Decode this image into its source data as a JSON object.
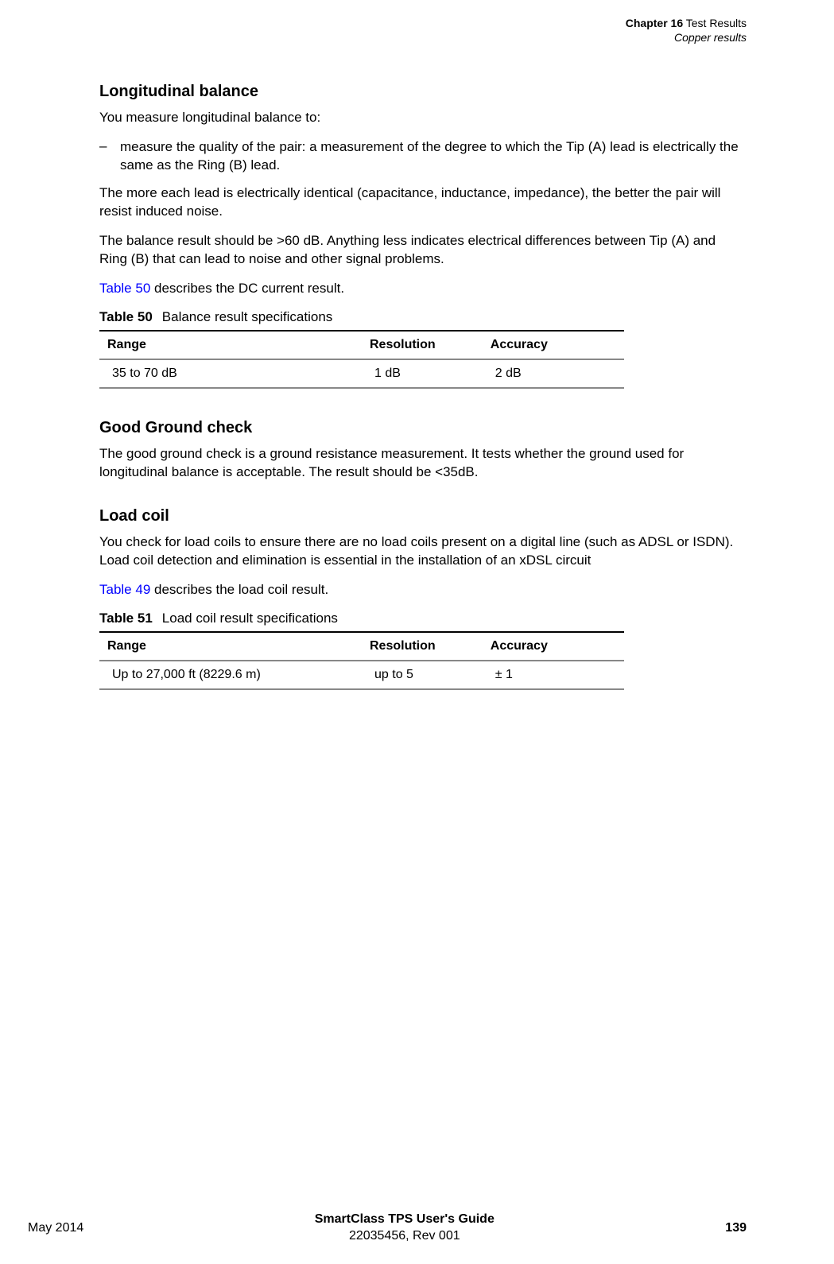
{
  "header": {
    "chapter_label": "Chapter 16",
    "chapter_title": "Test Results",
    "section_title": "Copper results"
  },
  "sections": {
    "longitudinal": {
      "heading": "Longitudinal balance",
      "intro": "You measure longitudinal balance to:",
      "bullet_dash": "–",
      "bullet_text": "measure the quality of the pair: a measurement of the degree to which the Tip (A) lead is electrically the same as the Ring (B) lead.",
      "para2": "The more each lead is electrically identical (capacitance, inductance, impedance), the better the pair will resist induced noise.",
      "para3": "The balance result should be >60 dB. Anything less indicates electrical differences between Tip (A) and Ring (B) that can lead to noise and other signal problems.",
      "para4_link": "Table 50",
      "para4_rest": " describes the DC current result.",
      "table_label": "Table 50",
      "table_title": "Balance result specifications",
      "table_headers": {
        "range": "Range",
        "resolution": "Resolution",
        "accuracy": "Accuracy"
      },
      "table_row": {
        "range": "35 to 70 dB",
        "resolution": "1 dB",
        "accuracy": "2 dB"
      }
    },
    "ground": {
      "heading": "Good Ground check",
      "para1": "The good ground check is a ground resistance measurement. It tests whether the ground used for longitudinal balance is acceptable. The result should be <35dB."
    },
    "loadcoil": {
      "heading": "Load coil",
      "para1": "You check for load coils to ensure there are no load coils present on a digital line (such as ADSL or ISDN). Load coil detection and elimination is essential in the installation of an xDSL circuit",
      "para2_link": "Table 49",
      "para2_rest": " describes the load coil result.",
      "table_label": "Table 51",
      "table_title": "Load coil result specifications",
      "table_headers": {
        "range": "Range",
        "resolution": "Resolution",
        "accuracy": "Accuracy"
      },
      "table_row": {
        "range": "Up to 27,000 ft (8229.6 m)",
        "resolution": "up to 5",
        "accuracy": "± 1"
      }
    }
  },
  "footer": {
    "left": "May 2014",
    "center_line1": "SmartClass TPS User's Guide",
    "center_line2": "22035456, Rev 001",
    "right": "139"
  }
}
